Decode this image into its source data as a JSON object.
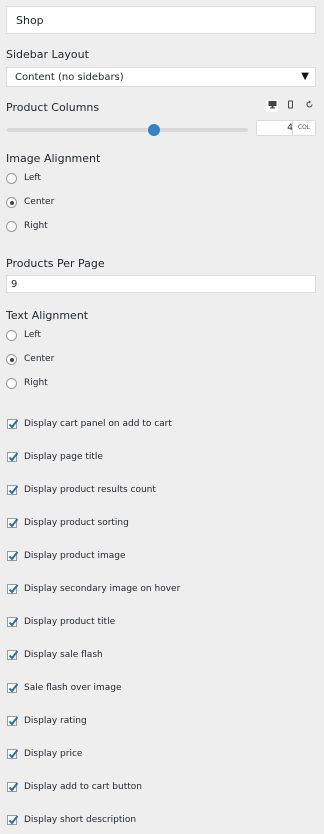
{
  "header": {
    "title": "Shop"
  },
  "sidebar_layout": {
    "label": "Sidebar Layout",
    "selected": "Content (no sidebars)"
  },
  "product_columns": {
    "label": "Product Columns",
    "value": "4",
    "unit": "COL",
    "slider_fraction": 0.61
  },
  "image_alignment": {
    "label": "Image Alignment",
    "options": [
      {
        "label": "Left",
        "selected": false
      },
      {
        "label": "Center",
        "selected": true
      },
      {
        "label": "Right",
        "selected": false
      }
    ]
  },
  "products_per_page": {
    "label": "Products Per Page",
    "value": "9"
  },
  "text_alignment": {
    "label": "Text Alignment",
    "options": [
      {
        "label": "Left",
        "selected": false
      },
      {
        "label": "Center",
        "selected": true
      },
      {
        "label": "Right",
        "selected": false
      }
    ]
  },
  "checkboxes": [
    {
      "label": "Display cart panel on add to cart",
      "checked": true
    },
    {
      "label": "Display page title",
      "checked": true
    },
    {
      "label": "Display product results count",
      "checked": true
    },
    {
      "label": "Display product sorting",
      "checked": true
    },
    {
      "label": "Display product image",
      "checked": true
    },
    {
      "label": "Display secondary image on hover",
      "checked": true
    },
    {
      "label": "Display product title",
      "checked": true
    },
    {
      "label": "Display sale flash",
      "checked": true
    },
    {
      "label": "Sale flash over image",
      "checked": true
    },
    {
      "label": "Display rating",
      "checked": true
    },
    {
      "label": "Display price",
      "checked": true
    },
    {
      "label": "Display add to cart button",
      "checked": true
    },
    {
      "label": "Display short description",
      "checked": true
    }
  ],
  "colors": {
    "accent": "#3582c4",
    "check": "#2271b1",
    "background": "#eeeeee"
  }
}
